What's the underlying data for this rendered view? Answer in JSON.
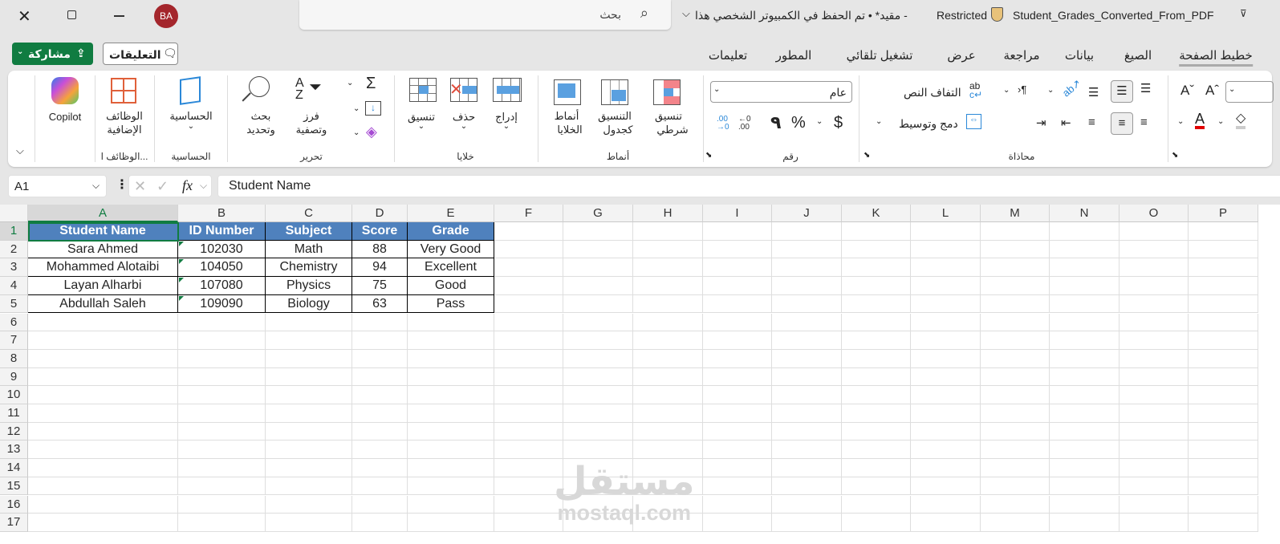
{
  "titlebar": {
    "filename": "Student_Grades_Converted_From_PDF",
    "sensitivity": "Restricted",
    "status": "- مقيد* • تم الحفظ في الكمبيوتر الشخصي هذا",
    "search_placeholder": "بحث",
    "avatar": "BA"
  },
  "actions": {
    "share": "مشاركة",
    "comments": "التعليقات"
  },
  "tabs": [
    "خطيط الصفحة",
    "الصيغ",
    "بيانات",
    "مراجعة",
    "عرض",
    "تشغيل تلقائي",
    "المطور",
    "تعليمات"
  ],
  "ribbon": {
    "copilot": "Copilot",
    "addins": {
      "label1": "الوظائف",
      "label2": "الإضافية",
      "group": "الوظائف ا..."
    },
    "calc": {
      "label": "الحساسية",
      "group": "الحساسية"
    },
    "editing": {
      "find1": "بحث",
      "find2": "وتحديد",
      "sort1": "فرز",
      "sort2": "وتصفية",
      "group": "تحرير"
    },
    "cells": {
      "format": "تنسيق",
      "delete": "حذف",
      "insert": "إدراج",
      "group": "خلايا"
    },
    "styles": {
      "cell1": "أنماط",
      "cell2": "الخلايا",
      "table1": "التنسيق",
      "table2": "كجدول",
      "cond1": "تنسيق",
      "cond2": "شرطي",
      "group": "أنماط"
    },
    "number": {
      "format": "عام",
      "currency": "$",
      "percent": "%",
      "comma": "٩",
      "group": "رقم"
    },
    "alignment": {
      "wrap": "التفاف النص",
      "merge": "دمج وتوسيط",
      "group": "محاذاة"
    }
  },
  "formula_bar": {
    "name_box": "A1",
    "fx": "fx",
    "content": "Student Name"
  },
  "sheet": {
    "columns": [
      "A",
      "B",
      "C",
      "D",
      "E",
      "F",
      "G",
      "H",
      "I",
      "J",
      "K",
      "L",
      "M",
      "N",
      "O",
      "P"
    ],
    "rows": [
      "1",
      "2",
      "3",
      "4",
      "5",
      "6",
      "7",
      "8",
      "9",
      "10",
      "11",
      "12",
      "13",
      "14",
      "15",
      "16",
      "17"
    ],
    "header": [
      "Student Name",
      "ID Number",
      "Subject",
      "Score",
      "Grade"
    ],
    "data": [
      [
        "Sara Ahmed",
        "102030",
        "Math",
        "88",
        "Very Good"
      ],
      [
        "Mohammed Alotaibi",
        "104050",
        "Chemistry",
        "94",
        "Excellent"
      ],
      [
        "Layan Alharbi",
        "107080",
        "Physics",
        "75",
        "Good"
      ],
      [
        "Abdullah Saleh",
        "109090",
        "Biology",
        "63",
        "Pass"
      ]
    ]
  },
  "watermark": {
    "arabic": "مستقل",
    "latin": "mostaql.com"
  },
  "colors": {
    "header_fill": "#4f81bd",
    "share": "#107c41",
    "avatar": "#a4262c"
  }
}
